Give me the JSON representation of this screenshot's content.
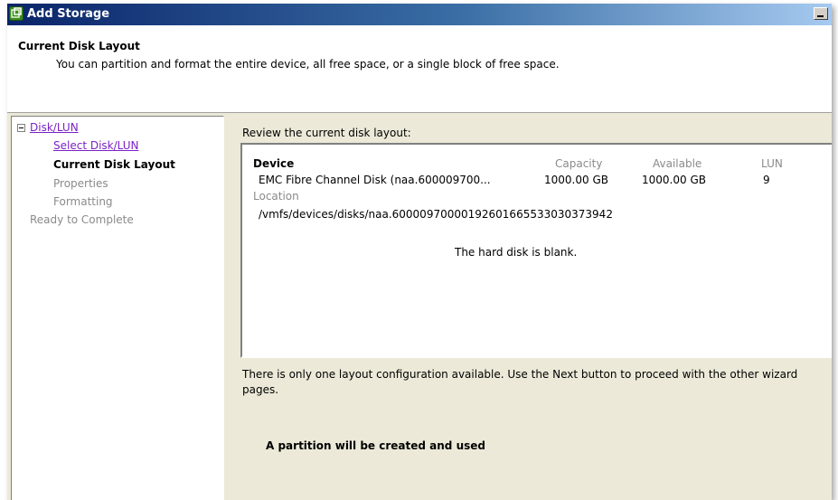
{
  "window": {
    "title": "Add Storage"
  },
  "header": {
    "title": "Current Disk Layout",
    "subtitle": "You can partition and format the entire device, all free space, or a single block of free space."
  },
  "nav": {
    "group_label": "Disk/LUN",
    "items": [
      {
        "label": "Select Disk/LUN",
        "state": "link"
      },
      {
        "label": "Current Disk Layout",
        "state": "current"
      },
      {
        "label": "Properties",
        "state": "disabled"
      },
      {
        "label": "Formatting",
        "state": "disabled"
      },
      {
        "label": "Ready to Complete",
        "state": "disabled"
      }
    ]
  },
  "content": {
    "review_label": "Review the current disk layout:",
    "table": {
      "device_header": "Device",
      "capacity_header": "Capacity",
      "available_header": "Available",
      "lun_header": "LUN",
      "device": "EMC Fibre Channel Disk (naa.600009700...",
      "capacity": "1000.00 GB",
      "available": "1000.00 GB",
      "lun": "9",
      "location_label": "Location",
      "location": "/vmfs/devices/disks/naa.60000970000192601665533030373942"
    },
    "blank_message": "The hard disk is blank.",
    "info": "There is only one layout configuration available. Use the Next button to proceed with the other wizard pages.",
    "partition_message": "A partition will be created and used"
  },
  "colors": {
    "link": "#7b22c4",
    "disabled": "#8a8a8a",
    "panel_bg": "#ece9d8",
    "title_bar": "#0a246a"
  },
  "icons": {
    "app": "add-storage-icon",
    "tree": "collapse-icon",
    "minimize": "minimize-icon"
  }
}
